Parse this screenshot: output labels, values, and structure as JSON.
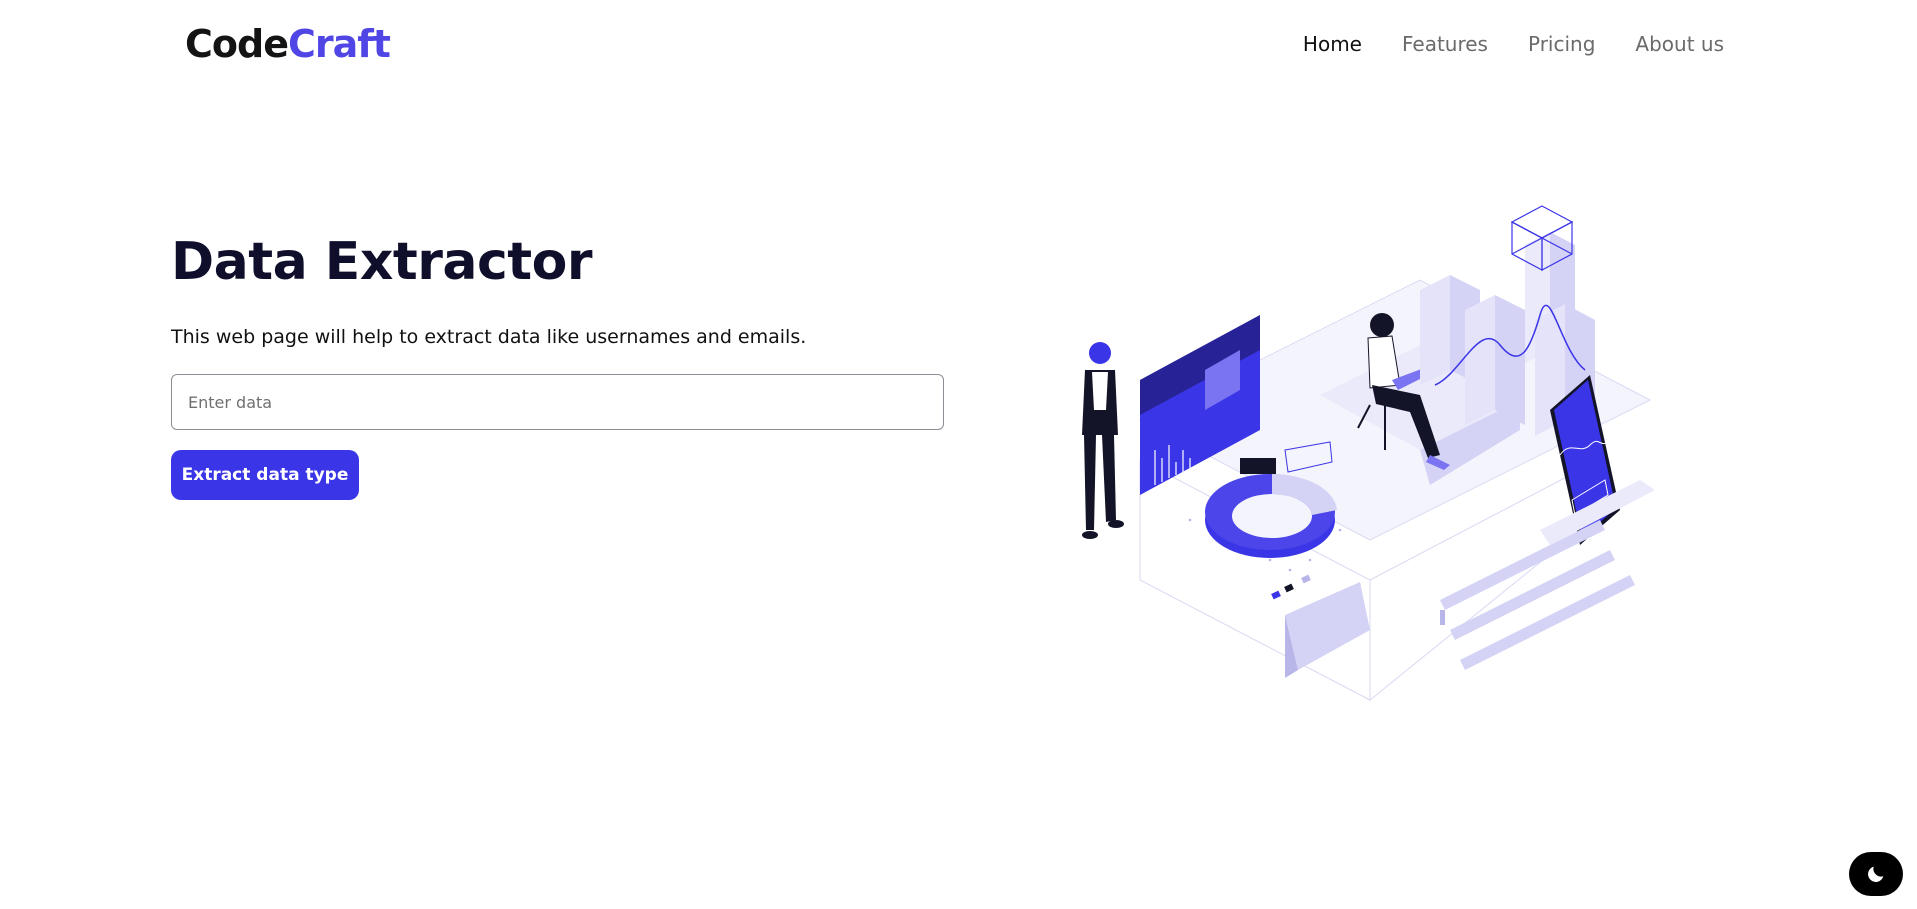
{
  "header": {
    "logo": {
      "part1": "Code",
      "part2": "Craft"
    },
    "nav": [
      {
        "label": "Home",
        "active": true
      },
      {
        "label": "Features",
        "active": false
      },
      {
        "label": "Pricing",
        "active": false
      },
      {
        "label": "About us",
        "active": false
      }
    ]
  },
  "hero": {
    "title": "Data Extractor",
    "subtitle": "This web page will help to extract data like usernames and emails.",
    "input": {
      "placeholder": "Enter data",
      "value": ""
    },
    "button_label": "Extract data type"
  },
  "theme_toggle": {
    "icon": "moon-icon"
  },
  "colors": {
    "accent": "#3b35e8",
    "logo_accent": "#4f46e5",
    "text_dark": "#0f0f2b",
    "nav_inactive": "#6b6b6b",
    "illustration_light": "#d4d3f5"
  }
}
